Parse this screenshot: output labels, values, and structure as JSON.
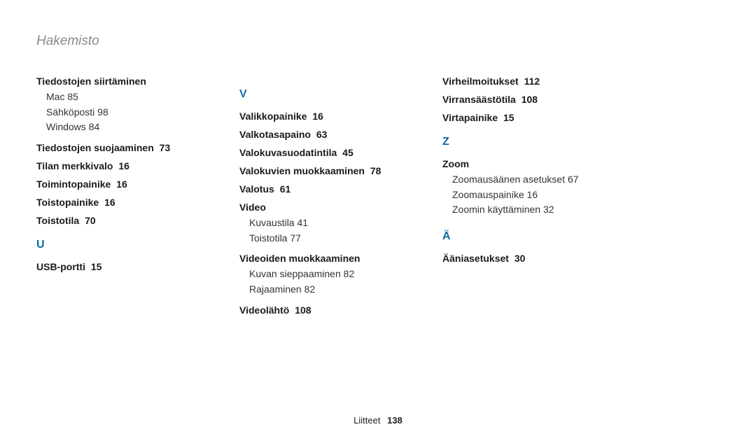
{
  "page_title": "Hakemisto",
  "footer": {
    "label": "Liitteet",
    "page": "138"
  },
  "columns": [
    {
      "blocks": [
        {
          "type": "entry",
          "title": "Tiedostojen siirtäminen",
          "subs": [
            {
              "label": "Mac",
              "page": "85"
            },
            {
              "label": "Sähköposti",
              "page": "98"
            },
            {
              "label": "Windows",
              "page": "84"
            }
          ]
        },
        {
          "type": "entry",
          "title": "Tiedostojen suojaaminen",
          "page": "73"
        },
        {
          "type": "entry",
          "title": "Tilan merkkivalo",
          "page": "16"
        },
        {
          "type": "entry",
          "title": "Toimintopainike",
          "page": "16"
        },
        {
          "type": "entry",
          "title": "Toistopainike",
          "page": "16"
        },
        {
          "type": "entry",
          "title": "Toistotila",
          "page": "70"
        },
        {
          "type": "letter",
          "label": "U"
        },
        {
          "type": "entry",
          "title": "USB-portti",
          "page": "15"
        }
      ]
    },
    {
      "blocks": [
        {
          "type": "letter",
          "label": "V"
        },
        {
          "type": "entry",
          "title": "Valikkopainike",
          "page": "16"
        },
        {
          "type": "entry",
          "title": "Valkotasapaino",
          "page": "63"
        },
        {
          "type": "entry",
          "title": "Valokuvasuodatintila",
          "page": "45"
        },
        {
          "type": "entry",
          "title": "Valokuvien muokkaaminen",
          "page": "78"
        },
        {
          "type": "entry",
          "title": "Valotus",
          "page": "61"
        },
        {
          "type": "entry",
          "title": "Video",
          "subs": [
            {
              "label": "Kuvaustila",
              "page": "41"
            },
            {
              "label": "Toistotila",
              "page": "77"
            }
          ]
        },
        {
          "type": "entry",
          "title": "Videoiden muokkaaminen",
          "subs": [
            {
              "label": "Kuvan sieppaaminen",
              "page": "82"
            },
            {
              "label": "Rajaaminen",
              "page": "82"
            }
          ]
        },
        {
          "type": "entry",
          "title": "Videolähtö",
          "page": "108"
        }
      ]
    },
    {
      "blocks": [
        {
          "type": "entry",
          "title": "Virheilmoitukset",
          "page": "112"
        },
        {
          "type": "entry",
          "title": "Virransäästötila",
          "page": "108"
        },
        {
          "type": "entry",
          "title": "Virtapainike",
          "page": "15"
        },
        {
          "type": "letter",
          "label": "Z"
        },
        {
          "type": "entry",
          "title": "Zoom",
          "subs": [
            {
              "label": "Zoomausäänen asetukset",
              "page": "67"
            },
            {
              "label": "Zoomauspainike",
              "page": "16"
            },
            {
              "label": "Zoomin käyttäminen",
              "page": "32"
            }
          ]
        },
        {
          "type": "letter",
          "label": "Ä"
        },
        {
          "type": "entry",
          "title": "Ääniasetukset",
          "page": "30"
        }
      ]
    }
  ]
}
